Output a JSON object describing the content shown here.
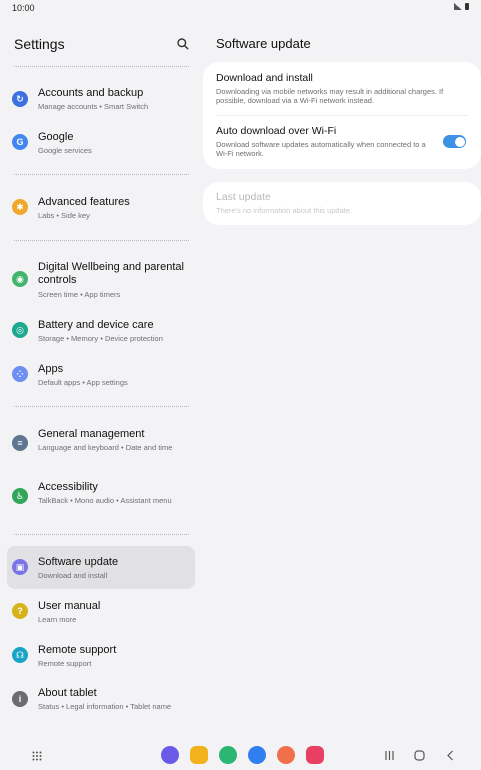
{
  "status_bar": {
    "time": "10:00"
  },
  "left_panel": {
    "title": "Settings",
    "items": [
      {
        "label": "Accounts and backup",
        "subtitle": "Manage accounts  •  Smart Switch",
        "icon": "sync-icon",
        "color": "#3d6fe0"
      },
      {
        "label": "Google",
        "subtitle": "Google services",
        "icon": "google-icon",
        "color": "#4386f0"
      },
      {
        "label": "Advanced features",
        "subtitle": "Labs  •  Side key",
        "icon": "gear-plus-icon",
        "color": "#f0a82a"
      },
      {
        "label": "Digital Wellbeing and parental controls",
        "subtitle": "Screen time  •  App timers",
        "icon": "wellbeing-icon",
        "color": "#41b56b"
      },
      {
        "label": "Battery and device care",
        "subtitle": "Storage  •  Memory  •  Device protection",
        "icon": "device-care-icon",
        "color": "#1ea88f"
      },
      {
        "label": "Apps",
        "subtitle": "Default apps  •  App settings",
        "icon": "apps-icon",
        "color": "#6d8ef2"
      },
      {
        "label": "General management",
        "subtitle": "Language and keyboard  •  Date and time",
        "icon": "sliders-icon",
        "color": "#5f7690"
      },
      {
        "label": "Accessibility",
        "subtitle": "TalkBack  •  Mono audio  •  Assistant menu",
        "icon": "accessibility-icon",
        "color": "#34a65a"
      },
      {
        "label": "Software update",
        "subtitle": "Download and install",
        "icon": "software-update-icon",
        "color": "#7a74e6"
      },
      {
        "label": "User manual",
        "subtitle": "Learn more",
        "icon": "manual-icon",
        "color": "#d7b21a"
      },
      {
        "label": "Remote support",
        "subtitle": "Remote support",
        "icon": "headset-icon",
        "color": "#19a4c7"
      },
      {
        "label": "About tablet",
        "subtitle": "Status  •  Legal information  •  Tablet name",
        "icon": "info-icon",
        "color": "#6b6b70"
      }
    ]
  },
  "right_panel": {
    "title": "Software update",
    "download": {
      "label": "Download and install",
      "subtitle": "Downloading via mobile networks may result in additional charges. If possible, download via a Wi-Fi network instead."
    },
    "auto_download": {
      "label": "Auto download over Wi-Fi",
      "subtitle": "Download software updates automatically when connected to a Wi-Fi network.",
      "enabled": true
    },
    "last_update": {
      "label": "Last update",
      "subtitle": "There's no information about this update."
    }
  },
  "dock_apps": [
    {
      "name": "internet-app-icon",
      "color": "#6b5ae8"
    },
    {
      "name": "my-files-app-icon",
      "color": "#f2b21b"
    },
    {
      "name": "phone-app-icon",
      "color": "#2bb673"
    },
    {
      "name": "messages-app-icon",
      "color": "#2f7ff0"
    },
    {
      "name": "contacts-app-icon",
      "color": "#f0704d"
    },
    {
      "name": "screen-recorder-app-icon",
      "color": "#e84063"
    }
  ],
  "accent": "#3e91e5"
}
